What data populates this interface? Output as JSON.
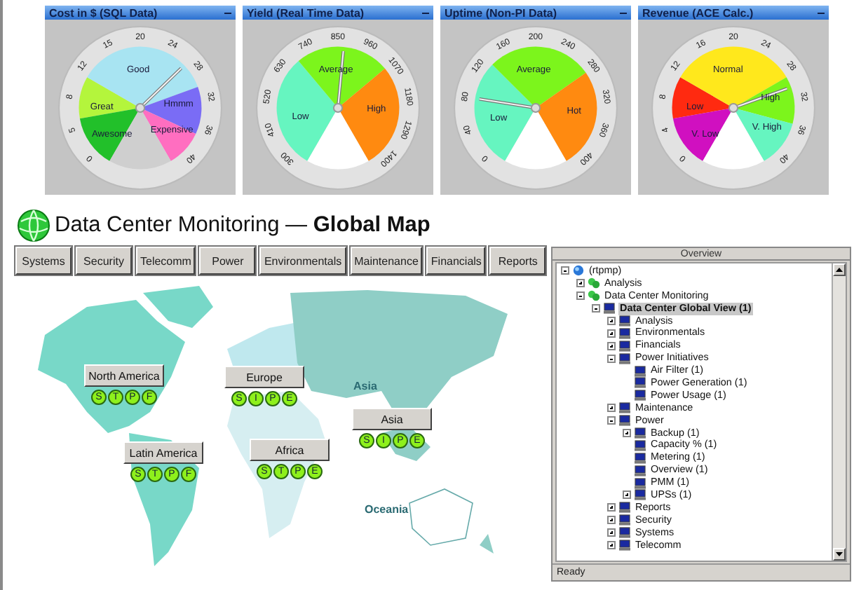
{
  "gauges": [
    {
      "title": "Cost in $ (SQL Data)",
      "ticks": [
        "0",
        "5",
        "8",
        "12",
        "15",
        "20",
        "24",
        "28",
        "32",
        "36",
        "40"
      ],
      "needle": {
        "level": 0.67
      },
      "segments": [
        {
          "label": "Great",
          "color": "#b4f53c"
        },
        {
          "label": "Awesome",
          "color": "#22c02a"
        },
        {
          "label": "Good",
          "color": "#a8e4f2"
        },
        {
          "label": "Hmmm",
          "color": "#7a6cf5"
        },
        {
          "label": "Expensive",
          "color": "#ff6ec0"
        },
        {
          "color": "#cfcfcf"
        }
      ]
    },
    {
      "title": "Yield (Real Time Data)",
      "ticks": [
        "300",
        "410",
        "520",
        "630",
        "740",
        "850",
        "960",
        "1070",
        "1180",
        "1290",
        "1400"
      ],
      "needle": {
        "level": 0.52
      },
      "segments": [
        {
          "label": "Low",
          "color": "#66f5c0"
        },
        {
          "label": "Average",
          "color": "#7cf51c"
        },
        {
          "label": "High",
          "color": "#ff8a10"
        },
        {
          "color": "#ffffff"
        }
      ]
    },
    {
      "title": "Uptime (Non-PI Data)",
      "ticks": [
        "0",
        "40",
        "80",
        "120",
        "160",
        "200",
        "240",
        "280",
        "320",
        "360",
        "400"
      ],
      "needle": {
        "level": 0.2
      },
      "segments": [
        {
          "label": "Low",
          "color": "#66f5c0"
        },
        {
          "label": "Average",
          "color": "#7cf51c"
        },
        {
          "label": "Hot",
          "color": "#ff8a10"
        },
        {
          "color": "#ffffff"
        }
      ]
    },
    {
      "title": "Revenue (ACE Calc.)",
      "ticks": [
        "0",
        "4",
        "8",
        "12",
        "16",
        "20",
        "24",
        "28",
        "32",
        "36",
        "40"
      ],
      "needle": {
        "level": 0.76
      },
      "segments": [
        {
          "label": "Low",
          "color": "#ff2a10"
        },
        {
          "label": "V. Low",
          "color": "#d010c0"
        },
        {
          "label": "Normal",
          "color": "#ffe81c"
        },
        {
          "label": "High",
          "color": "#7cf51c"
        },
        {
          "label": "V. High",
          "color": "#66f5c0"
        },
        {
          "color": "#ffffff"
        }
      ]
    }
  ],
  "heading": "Data Center Monitoring — **Global Map**",
  "nav": [
    "Systems",
    "Security",
    "Telecomm",
    "Power",
    "Environmentals",
    "Maintenance",
    "Financials",
    "Reports"
  ],
  "map": {
    "labels": [
      "Asia",
      "Oceania"
    ],
    "regions": [
      {
        "name": "North America",
        "badges": [
          "S",
          "T",
          "P",
          "F"
        ]
      },
      {
        "name": "Europe",
        "badges": [
          "S",
          "I",
          "P",
          "E"
        ]
      },
      {
        "name": "Asia",
        "badges": [
          "S",
          "I",
          "P",
          "E"
        ]
      },
      {
        "name": "Latin America",
        "badges": [
          "S",
          "T",
          "P",
          "F"
        ]
      },
      {
        "name": "Africa",
        "badges": [
          "S",
          "T",
          "P",
          "E"
        ]
      }
    ]
  },
  "tree": {
    "title": "Overview",
    "status": "Ready",
    "nodes": [
      {
        "label": "(rtpmp)",
        "kind": "root",
        "expanded": true,
        "selected": false,
        "children": [
          {
            "label": "Analysis",
            "kind": "group",
            "expanded": false,
            "selected": false
          },
          {
            "label": "Data Center Monitoring",
            "kind": "group",
            "expanded": true,
            "selected": false,
            "children": [
              {
                "label": "Data Center Global View (1)",
                "kind": "computer",
                "expanded": true,
                "selected": true,
                "children": [
                  {
                    "label": "Analysis",
                    "kind": "computer",
                    "expanded": false,
                    "selected": false
                  },
                  {
                    "label": "Environmentals",
                    "kind": "computer",
                    "expanded": false,
                    "selected": false
                  },
                  {
                    "label": "Financials",
                    "kind": "computer",
                    "expanded": false,
                    "selected": false
                  },
                  {
                    "label": "Power Initiatives",
                    "kind": "computer",
                    "expanded": true,
                    "selected": false,
                    "children": [
                      {
                        "label": "Air Filter (1)",
                        "kind": "computer",
                        "selected": false
                      },
                      {
                        "label": "Power Generation (1)",
                        "kind": "computer",
                        "selected": false
                      },
                      {
                        "label": "Power Usage (1)",
                        "kind": "computer",
                        "selected": false
                      }
                    ]
                  },
                  {
                    "label": "Maintenance",
                    "kind": "computer",
                    "expanded": false,
                    "selected": false
                  },
                  {
                    "label": "Power",
                    "kind": "computer",
                    "expanded": true,
                    "selected": false,
                    "children": [
                      {
                        "label": "Backup (1)",
                        "kind": "computer",
                        "expanded": false,
                        "selected": false
                      },
                      {
                        "label": "Capacity % (1)",
                        "kind": "computer",
                        "selected": false
                      },
                      {
                        "label": "Metering (1)",
                        "kind": "computer",
                        "selected": false
                      },
                      {
                        "label": "Overview (1)",
                        "kind": "computer",
                        "selected": false
                      },
                      {
                        "label": "PMM (1)",
                        "kind": "computer",
                        "selected": false
                      },
                      {
                        "label": "UPSs (1)",
                        "kind": "computer",
                        "expanded": false,
                        "selected": false
                      }
                    ]
                  },
                  {
                    "label": "Reports",
                    "kind": "computer",
                    "expanded": false,
                    "selected": false
                  },
                  {
                    "label": "Security",
                    "kind": "computer",
                    "expanded": false,
                    "selected": false
                  },
                  {
                    "label": "Systems",
                    "kind": "computer",
                    "expanded": false,
                    "selected": false
                  },
                  {
                    "label": "Telecomm",
                    "kind": "computer",
                    "expanded": false,
                    "selected": false
                  }
                ]
              }
            ]
          }
        ]
      }
    ]
  }
}
